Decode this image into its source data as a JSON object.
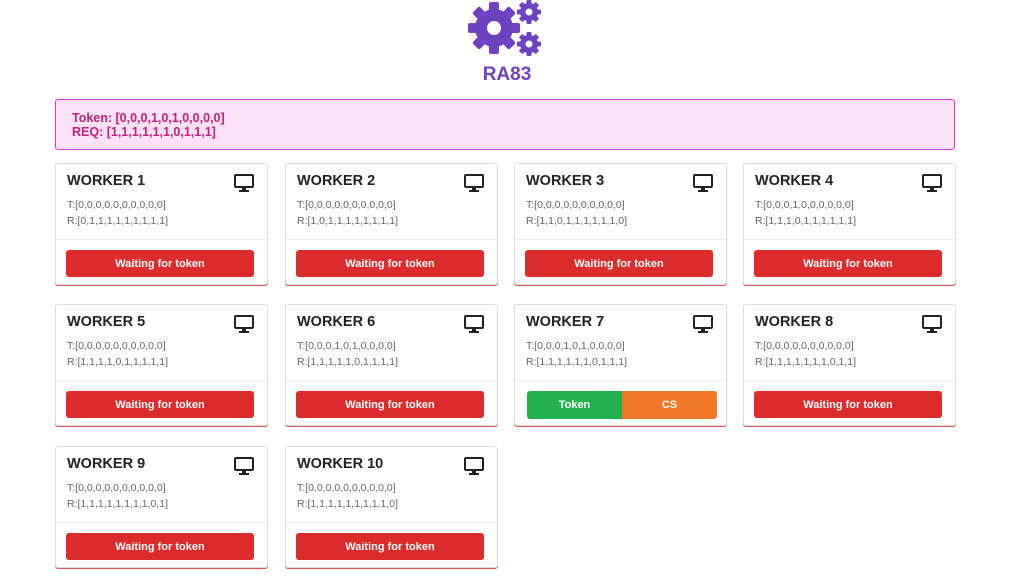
{
  "app": {
    "title": "RA83",
    "logo_icon": "gears-icon",
    "accent_color": "#6f42c1"
  },
  "token_panel": {
    "token_line": "Token: [0,0,0,1,0,1,0,0,0,0]",
    "req_line": "REQ: [1,1,1,1,1,1,0,1,1,1]"
  },
  "workers": [
    {
      "title": "WORKER 1",
      "t": "T:[0,0,0,0,0,0,0,0,0,0]",
      "r": "R:[0,1,1,1,1,1,1,1,1,1]",
      "status": "Waiting for token"
    },
    {
      "title": "WORKER 2",
      "t": "T:[0,0,0,0,0,0,0,0,0,0]",
      "r": "R:[1,0,1,1,1,1,1,1,1,1]",
      "status": "Waiting for token"
    },
    {
      "title": "WORKER 3",
      "t": "T:[0,0,0,0,0,0,0,0,0,0]",
      "r": "R:[1,1,0,1,1,1,1,1,1,0]",
      "status": "Waiting for token"
    },
    {
      "title": "WORKER 4",
      "t": "T:[0,0,0,1,0,0,0,0,0,0]",
      "r": "R:[1,1,1,0,1,1,1,1,1,1]",
      "status": "Waiting for token"
    },
    {
      "title": "WORKER 5",
      "t": "T:[0,0,0,0,0,0,0,0,0,0]",
      "r": "R:[1,1,1,1,0,1,1,1,1,1]",
      "status": "Waiting for token"
    },
    {
      "title": "WORKER 6",
      "t": "T:[0,0,0,1,0,1,0,0,0,0]",
      "r": "R:[1,1,1,1,1,0,1,1,1,1]",
      "status": "Waiting for token"
    },
    {
      "title": "WORKER 7",
      "t": "T:[0,0,0,1,0,1,0,0,0,0]",
      "r": "R:[1,1,1,1,1,1,0,1,1,1]",
      "status": "",
      "token_label": "Token",
      "cs_label": "CS"
    },
    {
      "title": "WORKER 8",
      "t": "T:[0,0,0,0,0,0,0,0,0,0]",
      "r": "R:[1,1,1,1,1,1,1,0,1,1]",
      "status": "Waiting for token"
    },
    {
      "title": "WORKER 9",
      "t": "T:[0,0,0,0,0,0,0,0,0,0]",
      "r": "R:[1,1,1,1,1,1,1,1,0,1]",
      "status": "Waiting for token"
    },
    {
      "title": "WORKER 10",
      "t": "T:[0,0,0,0,0,0,0,0,0,0]",
      "r": "R:[1,1,1,1,1,1,1,1,1,0]",
      "status": "Waiting for token"
    }
  ],
  "card_icon": "monitor-icon",
  "colors": {
    "waiting": "#dc2b2b",
    "token": "#22b14c",
    "cs": "#f0792a",
    "panel_bg": "#fde2f7",
    "panel_text": "#c2207a"
  }
}
